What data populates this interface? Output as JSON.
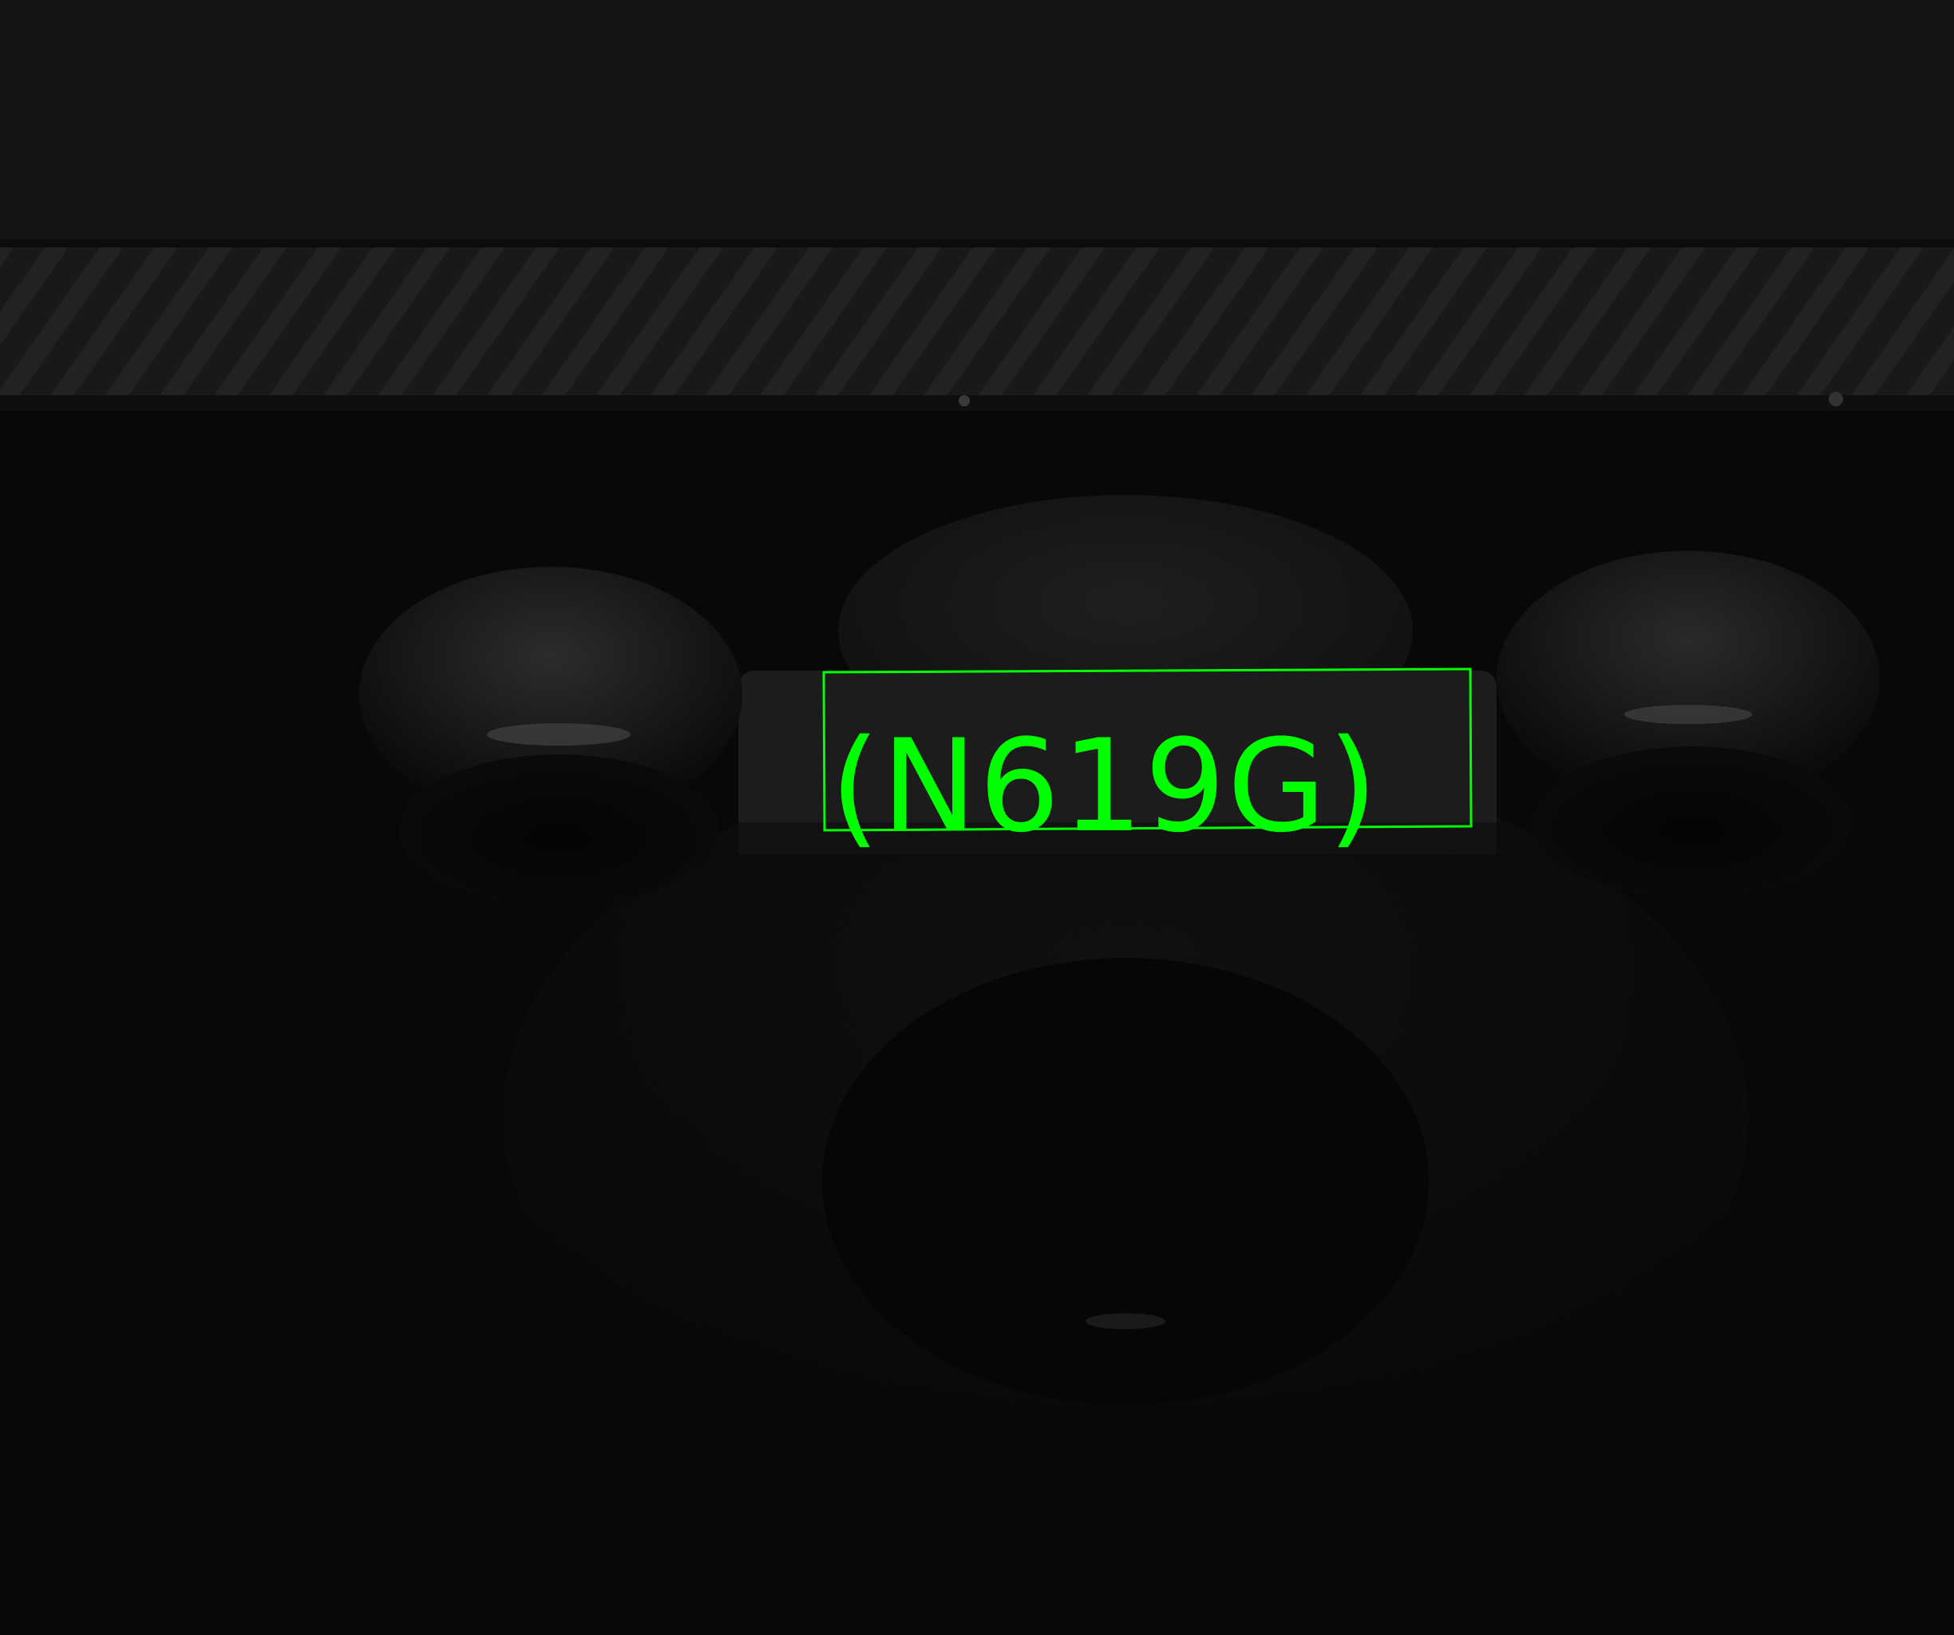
{
  "photo": {
    "subject": "cast-metal-part",
    "detection": {
      "text": "(N619G)",
      "color": "#00ff00"
    }
  }
}
